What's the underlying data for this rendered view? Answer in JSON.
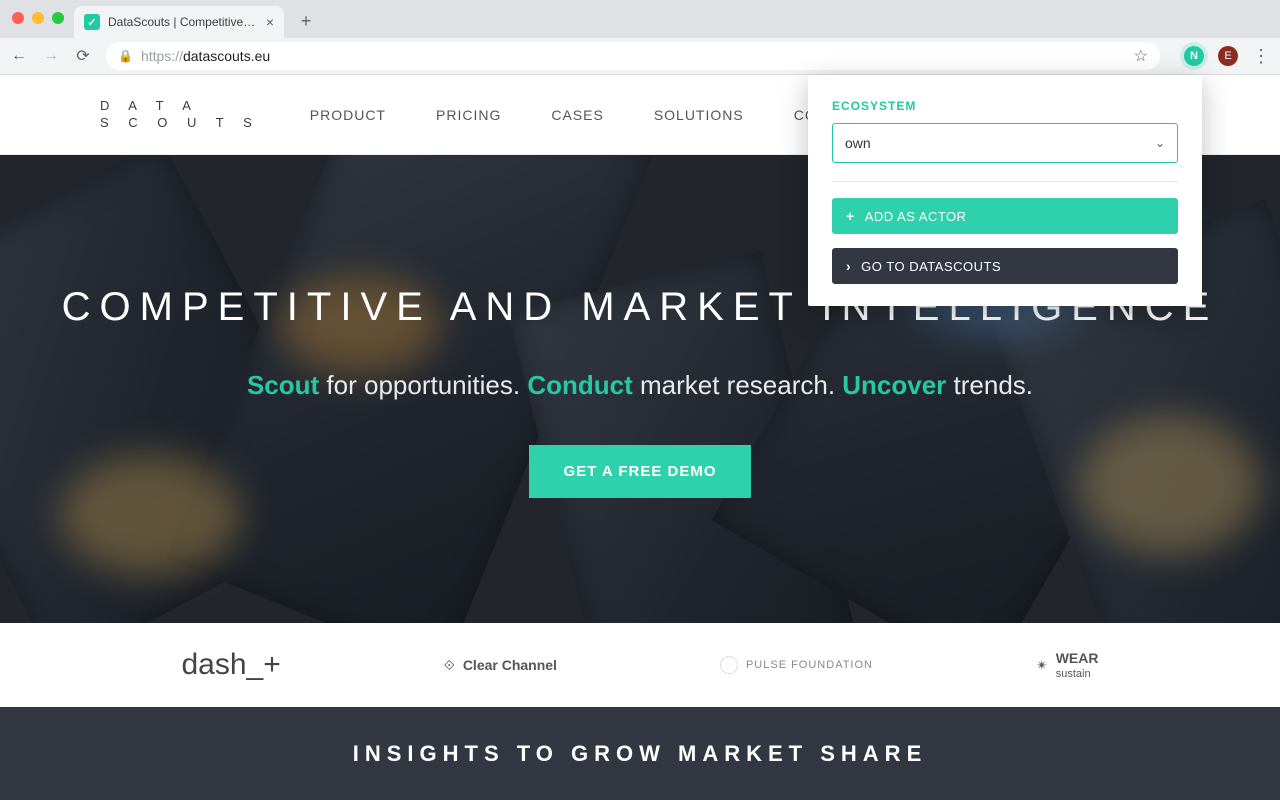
{
  "browser": {
    "tab_title": "DataScouts | Competitive Intell",
    "url_scheme": "https://",
    "url_host": "datascouts.eu",
    "new_tab_glyph": "+",
    "avatar_letter": "E",
    "favicon_glyph": "✓"
  },
  "nav": {
    "logo_line1": "D A T A",
    "logo_line2": "S C O U T S",
    "items": [
      {
        "label": "PRODUCT"
      },
      {
        "label": "PRICING"
      },
      {
        "label": "CASES"
      },
      {
        "label": "SOLUTIONS"
      },
      {
        "label": "CONTACT"
      }
    ]
  },
  "hero": {
    "headline": "COMPETITIVE AND MARKET INTELLIGENCE",
    "sub_parts": {
      "w1": "Scout",
      "t1": " for opportunities. ",
      "w2": "Conduct",
      "t2": " market research. ",
      "w3": "Uncover",
      "t3": " trends."
    },
    "cta_label": "GET A FREE DEMO"
  },
  "partners": {
    "p1": "dash_+",
    "p2": "Clear Channel",
    "p3": "PULSE FOUNDATION",
    "p4a": "WEAR",
    "p4b": "sustain"
  },
  "insights": {
    "heading": "INSIGHTS TO GROW MARKET SHARE"
  },
  "popup": {
    "section_label": "ECOSYSTEM",
    "select_value": "own",
    "add_label": "ADD AS ACTOR",
    "go_label": "GO TO DATASCOUTS"
  },
  "colors": {
    "accent": "#2fd0ac",
    "dark": "#333742"
  }
}
